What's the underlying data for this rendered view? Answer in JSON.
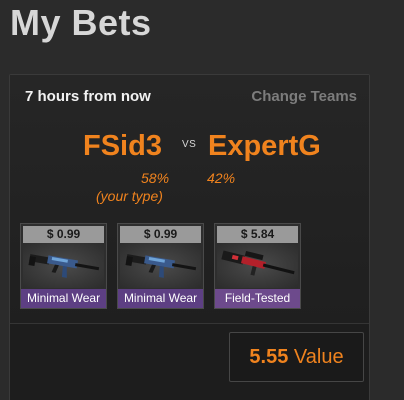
{
  "header": {
    "title": "My Bets"
  },
  "bet": {
    "time": "7 hours from now",
    "change_teams": "Change Teams",
    "team_left": "FSid3",
    "vs": "VS",
    "team_right": "ExpertG",
    "pct_left": "58%",
    "pct_right": "42%",
    "your_type": "(your type)"
  },
  "items": [
    {
      "price": "$ 0.99",
      "condition": "Minimal Wear",
      "icon": "ak47-rifle-icon"
    },
    {
      "price": "$ 0.99",
      "condition": "Minimal Wear",
      "icon": "ak47-rifle-icon"
    },
    {
      "price": "$ 5.84",
      "condition": "Field-Tested",
      "icon": "sniper-rifle-icon"
    }
  ],
  "value": {
    "amount": "5.55",
    "label": "Value"
  },
  "colors": {
    "accent": "#f0831e",
    "condition_purple": "#5d3f83",
    "background": "#2b2b2b"
  }
}
